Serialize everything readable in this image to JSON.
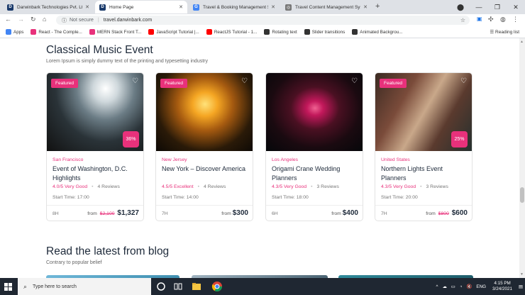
{
  "browser": {
    "tabs": [
      {
        "title": "Darwinbark Technologies Pvt. Ltd.",
        "active": false,
        "fav_color": "#1a3a6b",
        "fav_letter": "D"
      },
      {
        "title": "Home Page",
        "active": true,
        "fav_color": "#1a3a6b",
        "fav_letter": "D"
      },
      {
        "title": "Travel & Booking Management Sys",
        "active": false,
        "fav_color": "#4285f4",
        "fav_letter": "G"
      },
      {
        "title": "Travel Content Management Syste",
        "active": false,
        "fav_color": "#777777",
        "fav_letter": "◎"
      }
    ],
    "new_tab": "+",
    "address": {
      "security": "Not secure",
      "url": "travel.darwinbark.com"
    },
    "bookmarks": [
      {
        "label": "Apps",
        "icon_color": "#4285f4"
      },
      {
        "label": "React - The Comple...",
        "icon_color": "#e8317b"
      },
      {
        "label": "MERN Stack Front T...",
        "icon_color": "#e8317b"
      },
      {
        "label": "JavaScript Tutorial |...",
        "icon_color": "#ff0000"
      },
      {
        "label": "ReactJS Tutorial - 1...",
        "icon_color": "#ff0000"
      },
      {
        "label": "Rotating text",
        "icon_color": "#333333"
      },
      {
        "label": "Slider transitions",
        "icon_color": "#333333"
      },
      {
        "label": "Animated Backgrou...",
        "icon_color": "#333333"
      }
    ],
    "reading_list": "Reading list"
  },
  "section": {
    "title": "Classical Music Event",
    "subtitle": "Lorem Ipsum is simply dummy text of the printing and typesetting industry"
  },
  "cards": [
    {
      "featured": "Featured",
      "discount": "36%",
      "location": "San Francisco",
      "name": "Event of Washington, D.C. Highlights",
      "rating": "4.0/5 Very Good",
      "reviews": "4 Reviews",
      "start": "Start Time: 17:00",
      "duration": "8H",
      "from": "from",
      "old_price": "$2,100",
      "price": "$1,327"
    },
    {
      "featured": "Featured",
      "discount": "",
      "location": "New Jersey",
      "name": "New York – Discover America",
      "rating": "4.5/5 Excellent",
      "reviews": "4 Reviews",
      "start": "Start Time: 14:00",
      "duration": "7H",
      "from": "from",
      "old_price": "",
      "price": "$300"
    },
    {
      "featured": "",
      "discount": "",
      "location": "Los Angeles",
      "name": "Origami Crane Wedding Planners",
      "rating": "4.3/5 Very Good",
      "reviews": "3 Reviews",
      "start": "Start Time: 18:00",
      "duration": "6H",
      "from": "from",
      "old_price": "",
      "price": "$400"
    },
    {
      "featured": "Featured",
      "discount": "25%",
      "location": "United States",
      "name": "Northern Lights Event Planners",
      "rating": "4.3/5 Very Good",
      "reviews": "3 Reviews",
      "start": "Start Time: 20:00",
      "duration": "7H",
      "from": "from",
      "old_price": "$800",
      "price": "$600"
    }
  ],
  "blog": {
    "title": "Read the latest from blog",
    "subtitle": "Contrary to popular belief"
  },
  "taskbar": {
    "search_placeholder": "Type here to search",
    "lang": "ENG",
    "time": "4:15 PM",
    "date": "3/24/2021"
  },
  "colors": {
    "accent": "#e8317b",
    "heading": "#1e2a3a"
  }
}
